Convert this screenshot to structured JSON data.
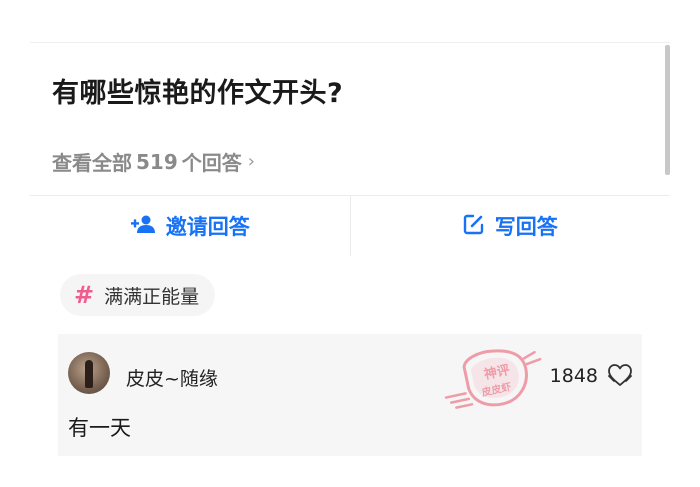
{
  "question": {
    "title": "有哪些惊艳的作文开头?",
    "view_all_prefix": "查看全部",
    "answer_count": "519",
    "view_all_suffix": "个回答",
    "chevron": "›"
  },
  "actions": {
    "invite_label": "邀请回答",
    "write_label": "写回答"
  },
  "topic": {
    "hash": "#",
    "label": "满满正能量"
  },
  "answer": {
    "author": "皮皮~随缘",
    "like_count": "1848",
    "excerpt": "有一天"
  },
  "watermark": {
    "top_text": "神评",
    "bottom_text": "皮皮虾"
  },
  "colors": {
    "accent_blue": "#1772f6",
    "topic_pink": "#ef5d8e",
    "watermark_red": "#e8546a"
  },
  "icons": {
    "invite": "add-user-icon",
    "write": "edit-icon",
    "like": "heart-hands-icon"
  }
}
